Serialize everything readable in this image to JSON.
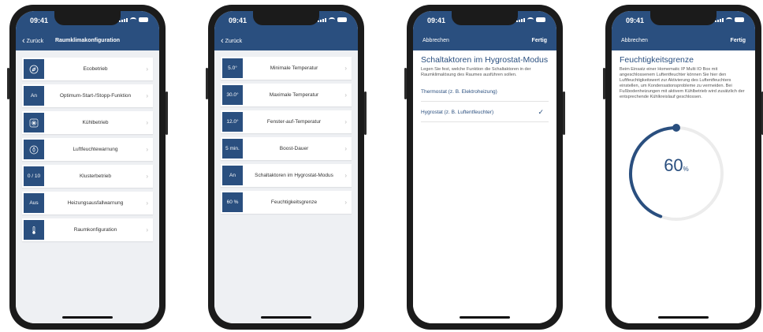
{
  "status": {
    "time": "09:41"
  },
  "screen1": {
    "back": "Zurück",
    "title": "Raumklimakonfiguration",
    "items": [
      {
        "badge_icon": "leaf-icon",
        "badge": "",
        "label": "Ecobetrieb"
      },
      {
        "badge_icon": "",
        "badge": "An",
        "label": "Optimum-Start-/Stopp-Funktion"
      },
      {
        "badge_icon": "snowflake-icon",
        "badge": "",
        "label": "Kühlbetrieb"
      },
      {
        "badge_icon": "droplet-icon",
        "badge": "",
        "label": "Luftfeuchtewarnung"
      },
      {
        "badge_icon": "",
        "badge": "0 / 10",
        "label": "Klusterbetrieb"
      },
      {
        "badge_icon": "",
        "badge": "Aus",
        "label": "Heizungsausfallwarnung"
      },
      {
        "badge_icon": "thermometer-icon",
        "badge": "",
        "label": "Raumkonfiguration"
      }
    ]
  },
  "screen2": {
    "back": "Zurück",
    "items": [
      {
        "badge": "5.0°",
        "label": "Minimale Temperatur"
      },
      {
        "badge": "30.0°",
        "label": "Maximale Temperatur"
      },
      {
        "badge": "12.0°",
        "label": "Fenster-auf-Temperatur"
      },
      {
        "badge": "5 min.",
        "label": "Boost-Dauer"
      },
      {
        "badge": "An",
        "label": "Schaltaktoren im Hygrostat-Modus"
      },
      {
        "badge": "60 %",
        "label": "Feuchtigkeitsgrenze"
      }
    ]
  },
  "screen3": {
    "cancel": "Abbrechen",
    "done": "Fertig",
    "heading": "Schaltaktoren im Hygrostat-Modus",
    "description": "Legen Sie fest, welche Funktion die Schaltaktoren in der Raumklimalösung des Raumes ausführen sollen.",
    "option1": "Thermostat (z. B. Elektroheizung)",
    "option2": "Hygrostat (z. B. Luftentfeuchter)"
  },
  "screen4": {
    "cancel": "Abbrechen",
    "done": "Fertig",
    "heading": "Feuchtigkeitsgrenze",
    "description": "Beim Einsatz einer Homematic IP Multi IO Box mit angeschlossenem Luftentfeuchter können Sie hier den Luftfeuchtigkeitswert zur Aktivierung des Luftentfeuchters einstellen, um Kondensationsprobleme zu vermeiden. Bei Fußbodenheizungen mit aktivem Kühlbetrieb wird zusätzlich der entsprechende Kühlkreislauf geschlossen.",
    "gauge_value": "60",
    "gauge_unit": "%",
    "gauge_fraction": 0.6
  },
  "colors": {
    "brand": "#2a4f7f",
    "list_bg": "#eef0f3"
  }
}
